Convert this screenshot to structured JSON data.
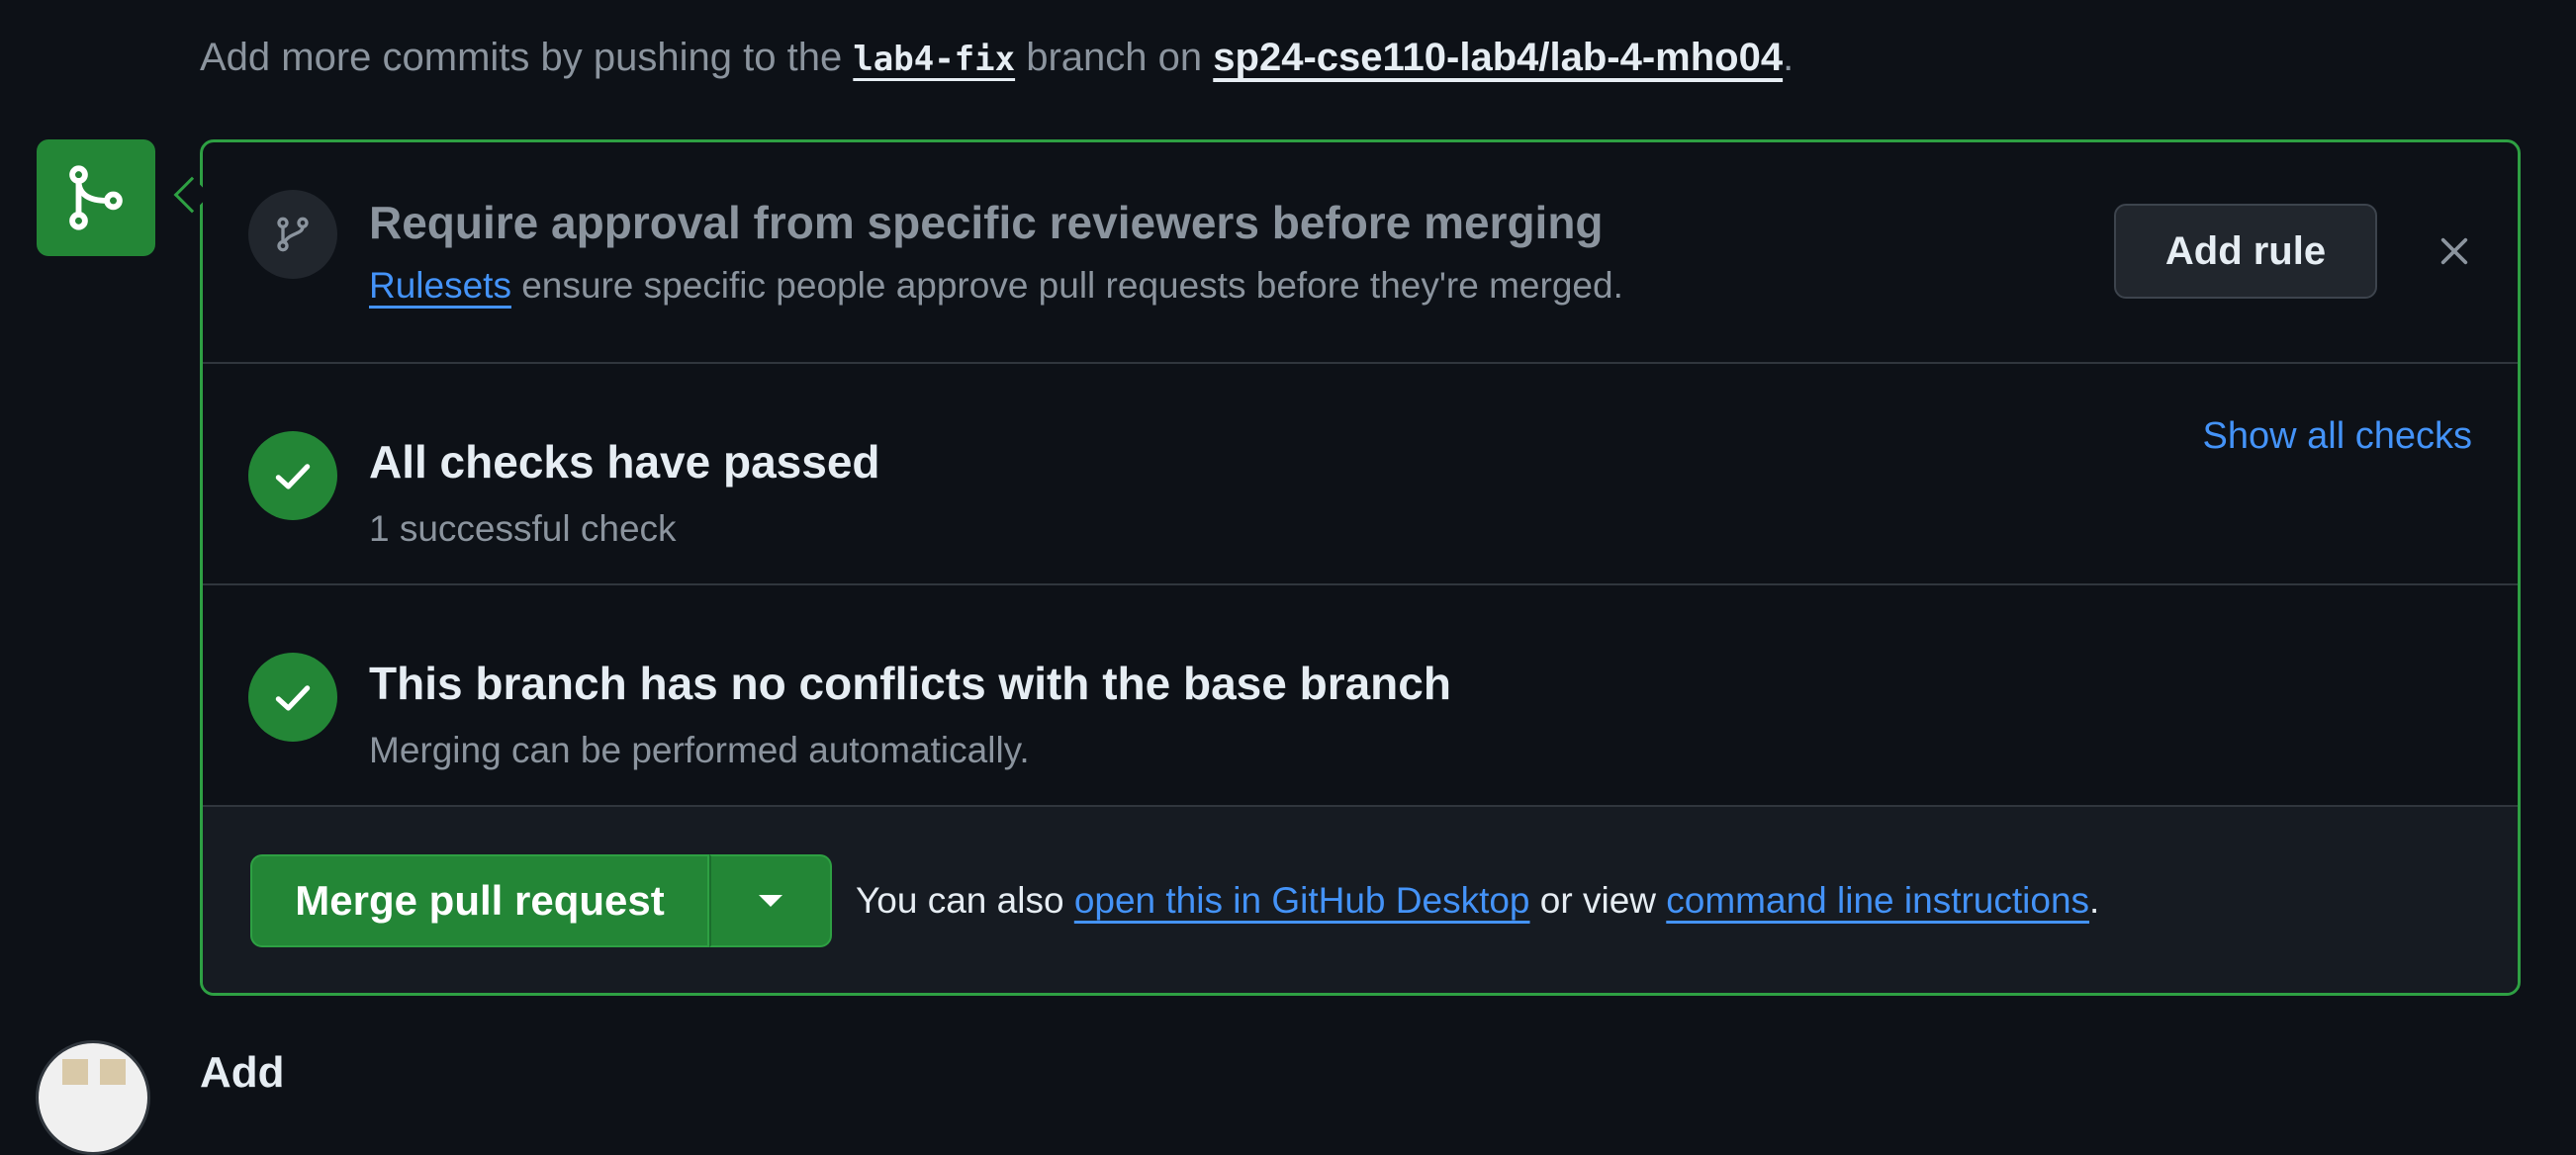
{
  "hint": {
    "prefix": "Add more commits by pushing to the",
    "branch": "lab4-fix",
    "middle": "branch on",
    "repo": "sp24-cse110-lab4/lab-4-mho04",
    "suffix": "."
  },
  "ruleset": {
    "title": "Require approval from specific reviewers before merging",
    "link": "Rulesets",
    "text": "ensure specific people approve pull requests before they're merged.",
    "add_rule_label": "Add rule"
  },
  "checks": {
    "title": "All checks have passed",
    "subtitle": "1 successful check",
    "show_all_label": "Show all checks"
  },
  "conflicts": {
    "title": "This branch has no conflicts with the base branch",
    "subtitle": "Merging can be performed automatically."
  },
  "merge": {
    "button_label": "Merge pull request",
    "note_prefix": "You can also",
    "desktop_link": "open this in GitHub Desktop",
    "note_middle": "or view",
    "cli_link": "command line instructions",
    "note_suffix": "."
  },
  "next_comment": {
    "label": "Add"
  },
  "colors": {
    "background": "#0d1117",
    "success_green": "#238636",
    "border_green": "#2ea043",
    "link_blue": "#4493f8",
    "muted_text": "#8b949e"
  },
  "icons": {
    "merge_box": "git-merge-icon",
    "ruleset": "git-branch-icon",
    "checks": "check-icon",
    "conflicts": "check-icon",
    "close": "close-icon",
    "dropdown": "triangle-down-icon"
  }
}
